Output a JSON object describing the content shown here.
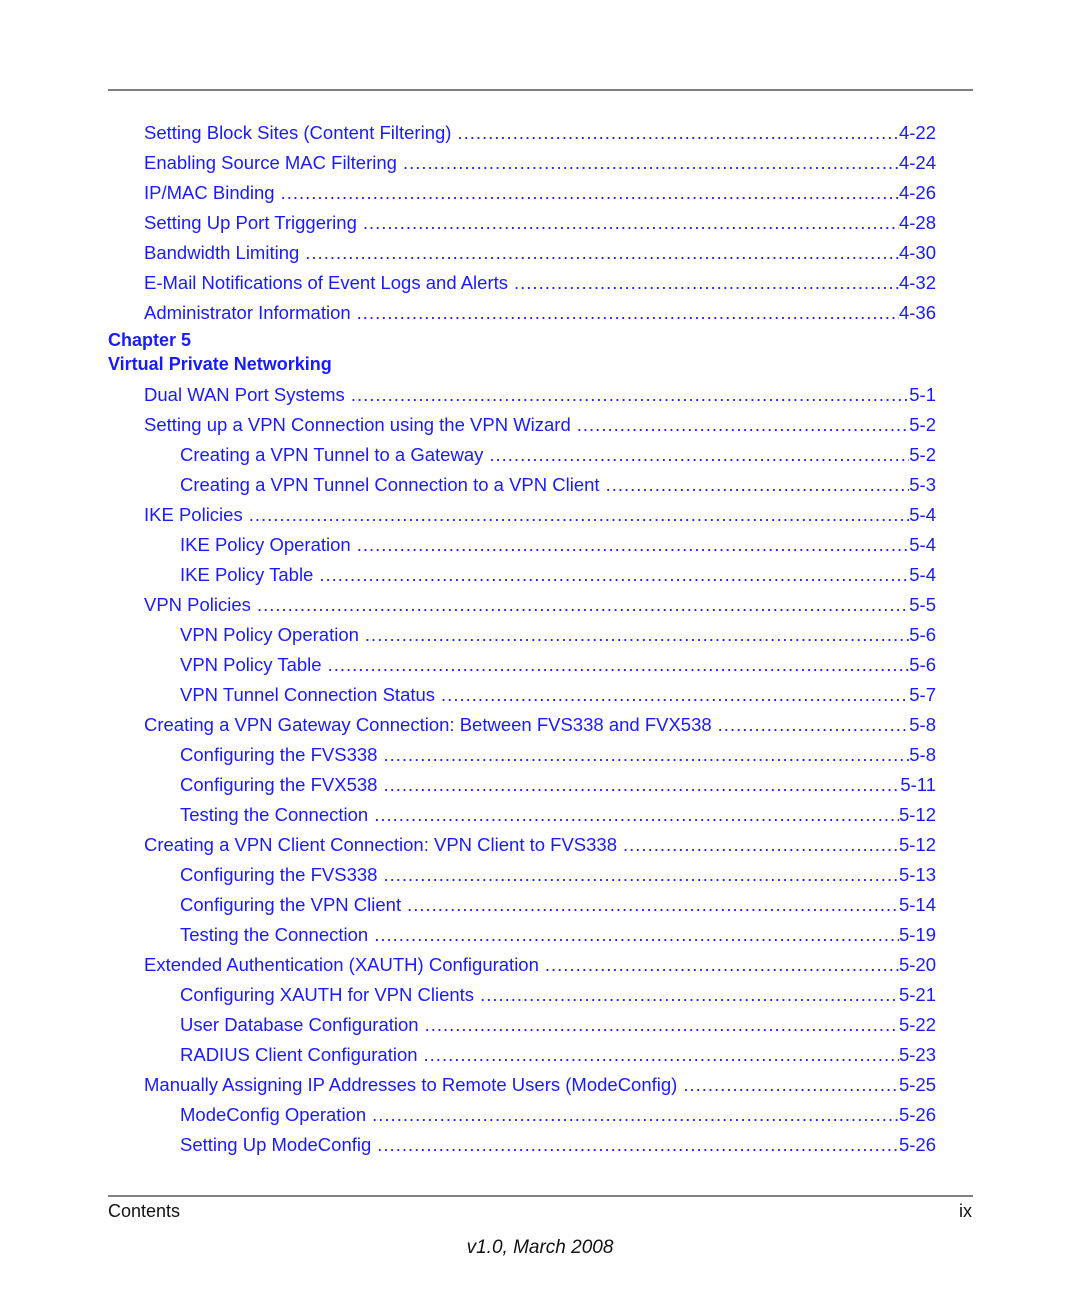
{
  "toc_top": [
    {
      "title": "Setting Block Sites (Content Filtering)",
      "page": "4-22",
      "level": 1
    },
    {
      "title": "Enabling Source MAC Filtering",
      "page": "4-24",
      "level": 1
    },
    {
      "title": "IP/MAC Binding",
      "page": "4-26",
      "level": 1
    },
    {
      "title": "Setting Up Port Triggering",
      "page": "4-28",
      "level": 1
    },
    {
      "title": "Bandwidth Limiting",
      "page": "4-30",
      "level": 1
    },
    {
      "title": "E-Mail Notifications of Event Logs and Alerts",
      "page": "4-32",
      "level": 1
    },
    {
      "title": "Administrator Information",
      "page": "4-36",
      "level": 1
    }
  ],
  "chapter": {
    "label": "Chapter 5",
    "title": "Virtual Private Networking"
  },
  "toc_chapter": [
    {
      "title": "Dual WAN Port Systems",
      "page": "5-1",
      "level": 1
    },
    {
      "title": "Setting up a VPN Connection using the VPN Wizard",
      "page": "5-2",
      "level": 1
    },
    {
      "title": "Creating a VPN Tunnel to a Gateway",
      "page": "5-2",
      "level": 2
    },
    {
      "title": "Creating a VPN Tunnel Connection to a VPN Client",
      "page": "5-3",
      "level": 2
    },
    {
      "title": "IKE Policies",
      "page": "5-4",
      "level": 1
    },
    {
      "title": "IKE Policy Operation",
      "page": "5-4",
      "level": 2
    },
    {
      "title": "IKE Policy Table",
      "page": "5-4",
      "level": 2
    },
    {
      "title": "VPN Policies",
      "page": "5-5",
      "level": 1
    },
    {
      "title": "VPN Policy Operation",
      "page": "5-6",
      "level": 2
    },
    {
      "title": "VPN Policy Table",
      "page": "5-6",
      "level": 2
    },
    {
      "title": "VPN Tunnel Connection Status",
      "page": "5-7",
      "level": 2
    },
    {
      "title": "Creating a VPN Gateway Connection: Between FVS338 and FVX538",
      "page": "5-8",
      "level": 1
    },
    {
      "title": "Configuring the FVS338",
      "page": "5-8",
      "level": 2
    },
    {
      "title": "Configuring the FVX538",
      "page": "5-11",
      "level": 2
    },
    {
      "title": "Testing the Connection",
      "page": "5-12",
      "level": 2
    },
    {
      "title": "Creating a VPN Client Connection: VPN Client to FVS338",
      "page": "5-12",
      "level": 1
    },
    {
      "title": "Configuring the FVS338",
      "page": "5-13",
      "level": 2
    },
    {
      "title": "Configuring the VPN Client",
      "page": "5-14",
      "level": 2
    },
    {
      "title": "Testing the Connection",
      "page": "5-19",
      "level": 2
    },
    {
      "title": "Extended Authentication (XAUTH) Configuration",
      "page": "5-20",
      "level": 1
    },
    {
      "title": "Configuring XAUTH for VPN Clients",
      "page": "5-21",
      "level": 2
    },
    {
      "title": "User Database Configuration",
      "page": "5-22",
      "level": 2
    },
    {
      "title": "RADIUS Client Configuration",
      "page": "5-23",
      "level": 2
    },
    {
      "title": "Manually Assigning IP Addresses to Remote Users (ModeConfig)",
      "page": "5-25",
      "level": 1
    },
    {
      "title": "ModeConfig Operation",
      "page": "5-26",
      "level": 2
    },
    {
      "title": "Setting Up ModeConfig",
      "page": "5-26",
      "level": 2
    }
  ],
  "footer": {
    "section": "Contents",
    "page_number": "ix",
    "version": "v1.0, March 2008"
  },
  "colors": {
    "link": "#1a1aff",
    "rule": "#808080",
    "text": "#111111"
  }
}
